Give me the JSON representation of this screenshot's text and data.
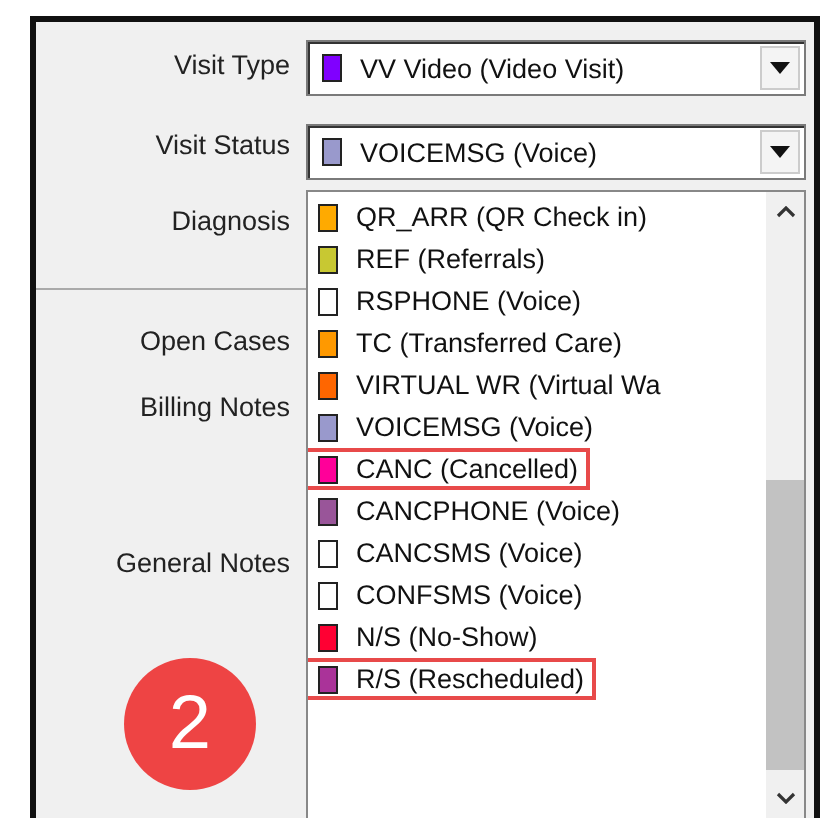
{
  "fields": [
    {
      "label": "Visit Type",
      "value": "VV Video (Video Visit)",
      "color": "#8000ff"
    },
    {
      "label": "Visit Status",
      "value": "VOICEMSG (Voice)",
      "color": "#9999cc"
    }
  ],
  "labels": [
    "Diagnosis",
    "Open Cases",
    "Billing Notes",
    "General Notes"
  ],
  "options": [
    {
      "text": "QR_ARR (QR Check in)",
      "color": "#ffaa00",
      "highlighted": false
    },
    {
      "text": "REF (Referrals)",
      "color": "#c8c832",
      "highlighted": false
    },
    {
      "text": "RSPHONE (Voice)",
      "color": "#ffffff",
      "highlighted": false
    },
    {
      "text": "TC (Transferred Care)",
      "color": "#ff9900",
      "highlighted": false
    },
    {
      "text": "VIRTUAL WR (Virtual Wa",
      "color": "#ff6600",
      "highlighted": false
    },
    {
      "text": "VOICEMSG (Voice)",
      "color": "#9999cc",
      "highlighted": false
    },
    {
      "text": "CANC (Cancelled)",
      "color": "#ff0099",
      "highlighted": true
    },
    {
      "text": "CANCPHONE (Voice)",
      "color": "#995599",
      "highlighted": false
    },
    {
      "text": "CANCSMS (Voice)",
      "color": "#ffffff",
      "highlighted": false
    },
    {
      "text": "CONFSMS (Voice)",
      "color": "#ffffff",
      "highlighted": false
    },
    {
      "text": "N/S (No-Show)",
      "color": "#ff0033",
      "highlighted": false
    },
    {
      "text": "R/S (Rescheduled)",
      "color": "#aa3399",
      "highlighted": true
    }
  ],
  "step_badge": "2"
}
